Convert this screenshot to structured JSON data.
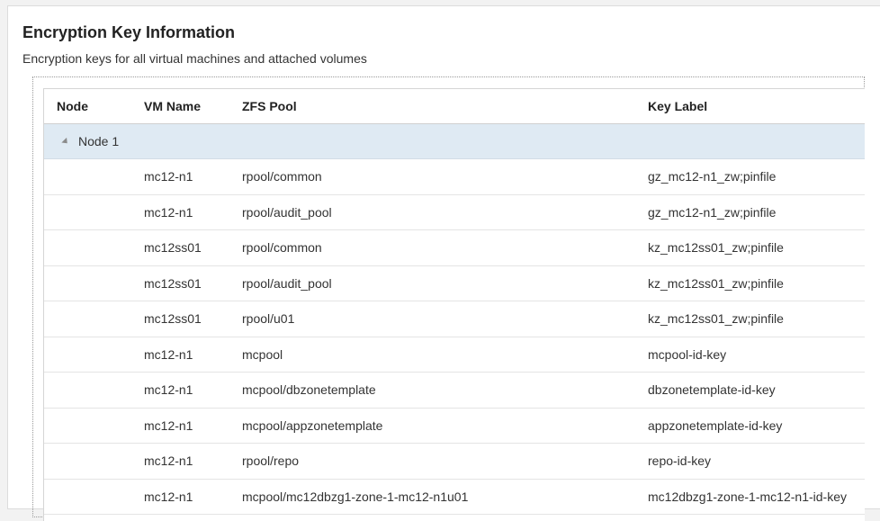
{
  "title": "Encryption Key Information",
  "subtitle": "Encryption keys for all virtual machines and attached volumes",
  "table": {
    "headers": {
      "node": "Node",
      "vm": "VM Name",
      "pool": "ZFS Pool",
      "key": "Key Label"
    },
    "group": {
      "label": "Node 1",
      "expanded": true
    },
    "rows": [
      {
        "vm": "mc12-n1",
        "pool": "rpool/common",
        "key": "gz_mc12-n1_zw;pinfile"
      },
      {
        "vm": "mc12-n1",
        "pool": "rpool/audit_pool",
        "key": "gz_mc12-n1_zw;pinfile"
      },
      {
        "vm": "mc12ss01",
        "pool": "rpool/common",
        "key": "kz_mc12ss01_zw;pinfile"
      },
      {
        "vm": "mc12ss01",
        "pool": "rpool/audit_pool",
        "key": "kz_mc12ss01_zw;pinfile"
      },
      {
        "vm": "mc12ss01",
        "pool": "rpool/u01",
        "key": "kz_mc12ss01_zw;pinfile"
      },
      {
        "vm": "mc12-n1",
        "pool": "mcpool",
        "key": "mcpool-id-key"
      },
      {
        "vm": "mc12-n1",
        "pool": "mcpool/dbzonetemplate",
        "key": "dbzonetemplate-id-key"
      },
      {
        "vm": "mc12-n1",
        "pool": "mcpool/appzonetemplate",
        "key": "appzonetemplate-id-key"
      },
      {
        "vm": "mc12-n1",
        "pool": "rpool/repo",
        "key": "repo-id-key"
      },
      {
        "vm": "mc12-n1",
        "pool": "mcpool/mc12dbzg1-zone-1-mc12-n1u01",
        "key": "mc12dbzg1-zone-1-mc12-n1-id-key"
      }
    ]
  }
}
